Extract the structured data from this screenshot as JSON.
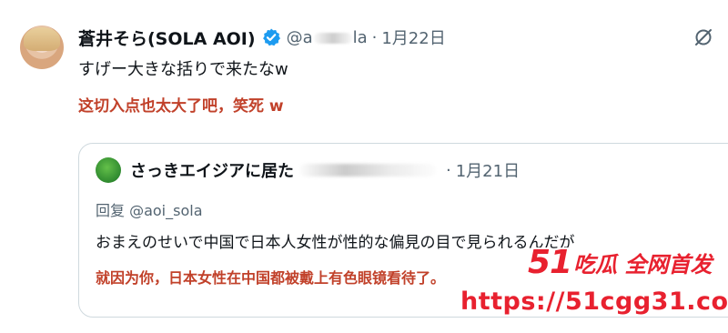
{
  "post": {
    "display_name": "蒼井そら(SOLA AOI)",
    "handle_prefix": "@a",
    "handle_suffix": "la",
    "separator": "·",
    "date": "1月22日",
    "text": "すげー大きな括りで来たなw",
    "translation": "这切入点也太大了吧，笑死 w",
    "verified_icon": "verified-badge-icon",
    "more_icon": "grok-icon"
  },
  "quoted": {
    "display_name": "さっきエイジアに居た",
    "separator": "·",
    "date": "1月21日",
    "reply_label": "回复 @aoi_sola",
    "text": "おまえのせいで中国で日本人女性が性的な偏見の目で見られるんだが",
    "translation": "就因为你，日本女性在中国都被戴上有色眼镜看待了。"
  },
  "watermark": {
    "number": "51",
    "brand": "吃瓜 全网首发",
    "url": "https://51cgg31.com"
  },
  "colors": {
    "accent_red": "#c1412a",
    "verified_blue": "#1d9bf0",
    "watermark_red": "#e8212f",
    "muted_gray": "#536471"
  }
}
